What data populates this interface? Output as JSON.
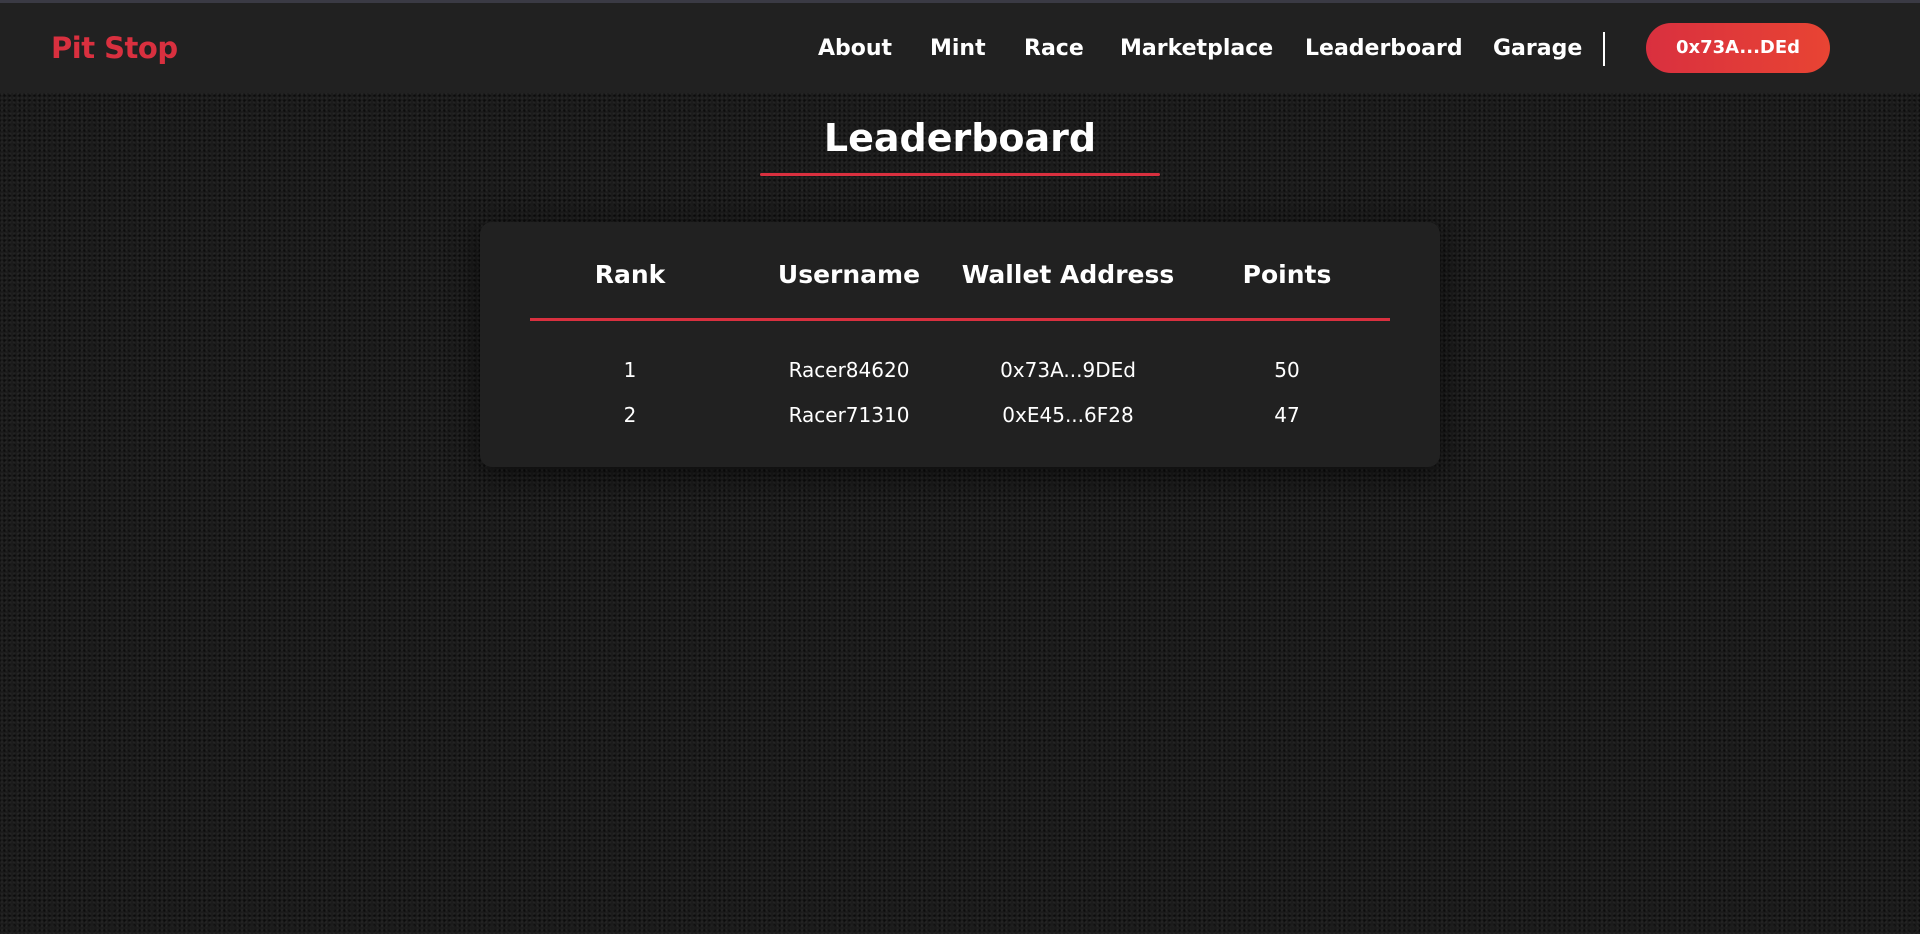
{
  "theme": {
    "accent": "#d9303f",
    "accent_end": "#e84433",
    "nav_bg": "#212121",
    "page_bg": "#1b1b1b"
  },
  "nav": {
    "brand": "Pit Stop",
    "links": [
      "About",
      "Mint",
      "Race",
      "Marketplace",
      "Leaderboard",
      "Garage"
    ],
    "wallet_button": "0x73A...DEd"
  },
  "page": {
    "title": "Leaderboard"
  },
  "leaderboard": {
    "columns": [
      "Rank",
      "Username",
      "Wallet Address",
      "Points"
    ],
    "rows": [
      [
        "1",
        "Racer84620",
        "0x73A...9DEd",
        "50"
      ],
      [
        "2",
        "Racer71310",
        "0xE45...6F28",
        "47"
      ]
    ]
  }
}
